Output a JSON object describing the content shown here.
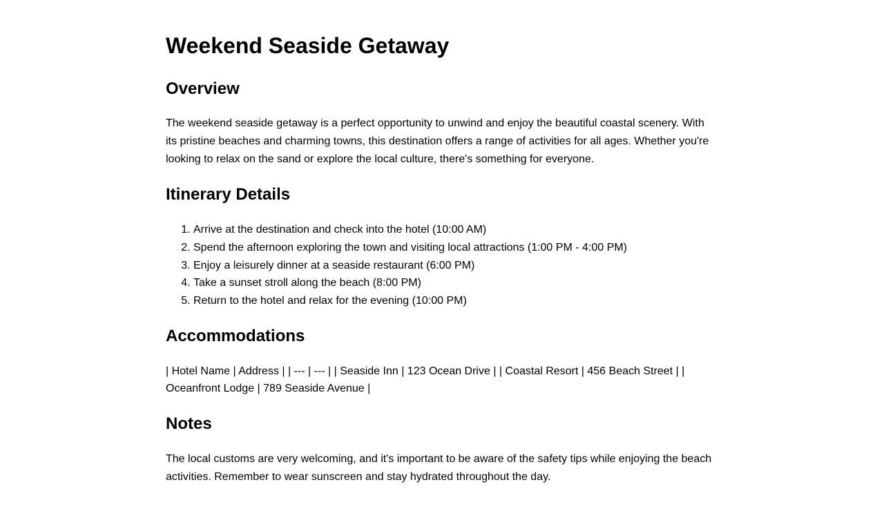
{
  "title": "Weekend Seaside Getaway",
  "overview": {
    "heading": "Overview",
    "text": "The weekend seaside getaway is a perfect opportunity to unwind and enjoy the beautiful coastal scenery. With its pristine beaches and charming towns, this destination offers a range of activities for all ages. Whether you're looking to relax on the sand or explore the local culture, there's something for everyone."
  },
  "itinerary": {
    "heading": "Itinerary Details",
    "items": [
      "Arrive at the destination and check into the hotel (10:00 AM)",
      "Spend the afternoon exploring the town and visiting local attractions (1:00 PM - 4:00 PM)",
      "Enjoy a leisurely dinner at a seaside restaurant (6:00 PM)",
      "Take a sunset stroll along the beach (8:00 PM)",
      "Return to the hotel and relax for the evening (10:00 PM)"
    ]
  },
  "accommodations": {
    "heading": "Accommodations",
    "text": "| Hotel Name | Address | | --- | --- | | Seaside Inn | 123 Ocean Drive | | Coastal Resort | 456 Beach Street | | Oceanfront Lodge | 789 Seaside Avenue |"
  },
  "notes": {
    "heading": "Notes",
    "text": "The local customs are very welcoming, and it's important to be aware of the safety tips while enjoying the beach activities. Remember to wear sunscreen and stay hydrated throughout the day."
  }
}
